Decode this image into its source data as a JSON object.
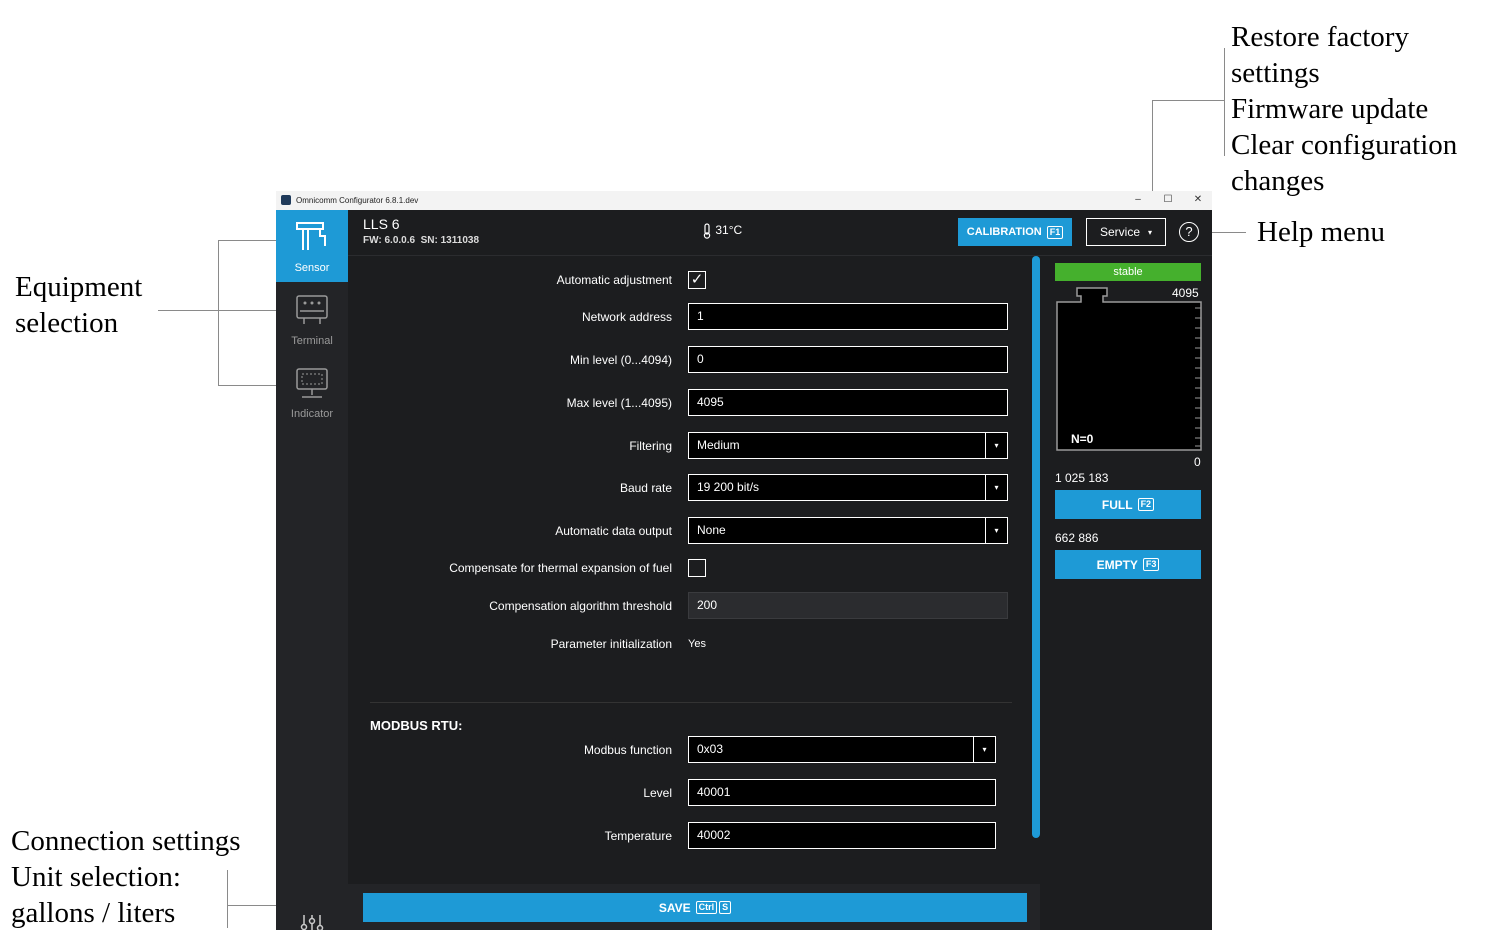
{
  "annotations": {
    "service_menu": [
      "Restore factory",
      "settings",
      "Firmware update",
      "Clear configuration",
      "changes"
    ],
    "help_menu": "Help menu",
    "equipment": [
      "Equipment",
      "selection"
    ],
    "connection": [
      "Connection settings",
      "Unit selection:",
      "gallons / liters"
    ]
  },
  "window": {
    "title": "Omnicomm Configurator 6.8.1.dev",
    "controls": {
      "minimize": "–",
      "maximize": "☐",
      "close": "✕"
    }
  },
  "sidebar": {
    "items": [
      {
        "label": "Sensor",
        "icon": "sensor-icon",
        "active": true
      },
      {
        "label": "Terminal",
        "icon": "terminal-icon",
        "active": false
      },
      {
        "label": "Indicator",
        "icon": "indicator-icon",
        "active": false
      }
    ],
    "bottom_icon": "settings-sliders-icon"
  },
  "header": {
    "device": "LLS 6",
    "fw": "FW: 6.0.0.6",
    "sn": "SN: 1311038",
    "temperature": "31°C",
    "calibration_label": "CALIBRATION",
    "calibration_key": "F1",
    "service_label": "Service",
    "help_symbol": "?"
  },
  "form": {
    "auto_adjust": {
      "label": "Automatic adjustment",
      "checked": true,
      "mark": "✓"
    },
    "network_address": {
      "label": "Network address",
      "value": "1"
    },
    "min_level": {
      "label": "Min level (0...4094)",
      "value": "0"
    },
    "max_level": {
      "label": "Max level (1...4095)",
      "value": "4095"
    },
    "filtering": {
      "label": "Filtering",
      "value": "Medium"
    },
    "baud_rate": {
      "label": "Baud rate",
      "value": "19 200 bit/s"
    },
    "auto_output": {
      "label": "Automatic data output",
      "value": "None"
    },
    "compensate": {
      "label": "Compensate for thermal expansion of fuel",
      "checked": false
    },
    "comp_threshold": {
      "label": "Compensation algorithm threshold",
      "value": "200"
    },
    "param_init": {
      "label": "Parameter initialization",
      "value": "Yes"
    }
  },
  "modbus": {
    "title": "MODBUS RTU:",
    "function": {
      "label": "Modbus function",
      "value": "0x03"
    },
    "level": {
      "label": "Level",
      "value": "40001"
    },
    "temperature": {
      "label": "Temperature",
      "value": "40002"
    }
  },
  "save": {
    "label": "SAVE",
    "key1": "Ctrl",
    "key2": "S"
  },
  "right_panel": {
    "status": "stable",
    "status_color": "#45b02d",
    "max": "4095",
    "n_label": "N=0",
    "zero": "0",
    "full_value": "1 025 183",
    "full_label": "FULL",
    "full_key": "F2",
    "empty_value": "662 886",
    "empty_label": "EMPTY",
    "empty_key": "F3"
  },
  "colors": {
    "accent": "#1e9ad6",
    "background": "#1c1d1f",
    "sidebar": "#232427"
  }
}
